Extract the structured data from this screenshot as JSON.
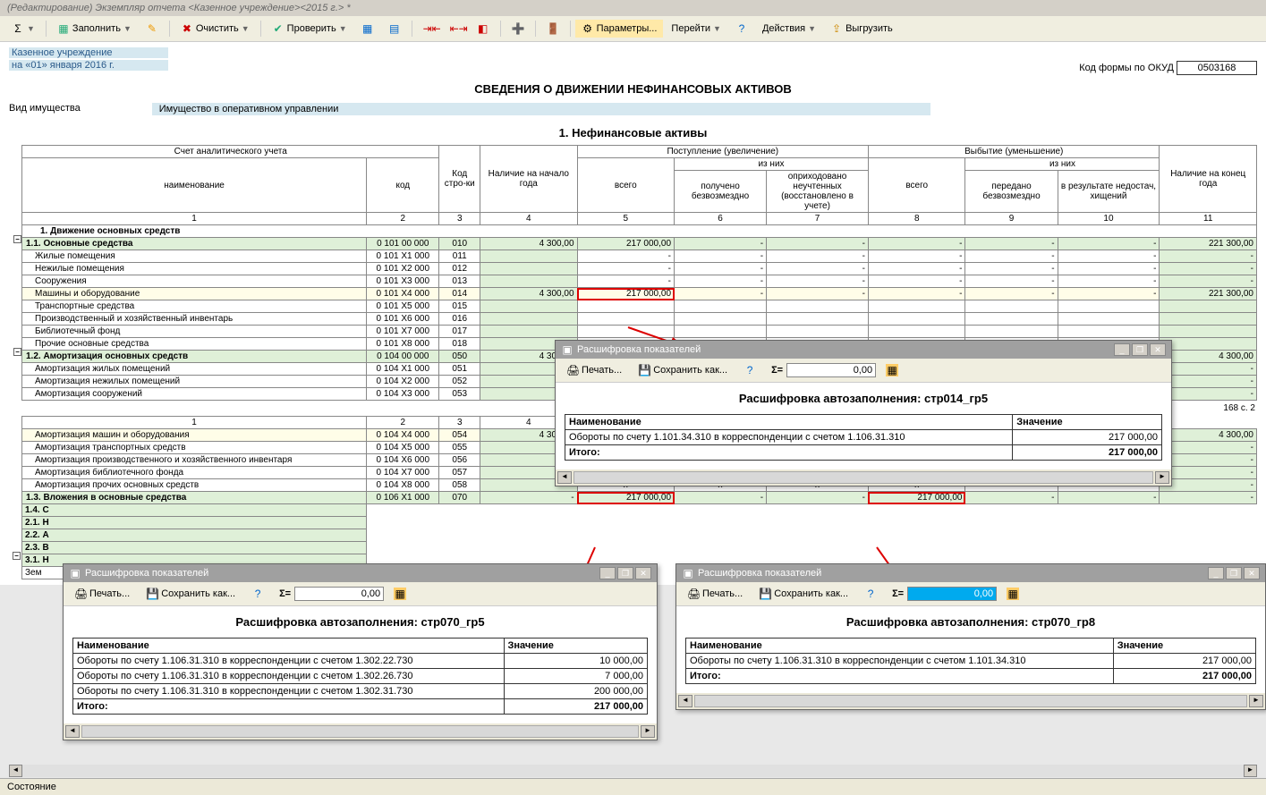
{
  "window_title": "(Редактирование) Экземпляр отчета <Казенное учреждение><2015 г.> *",
  "toolbar": {
    "fill": "Заполнить",
    "clear": "Очистить",
    "check": "Проверить",
    "params": "Параметры...",
    "goto": "Перейти",
    "actions": "Действия",
    "export": "Выгрузить"
  },
  "header": {
    "org": "Казенное учреждение",
    "date": "на «01» января 2016 г.",
    "okud_label": "Код формы по ОКУД",
    "okud_value": "0503168",
    "main_title": "СВЕДЕНИЯ О ДВИЖЕНИИ НЕФИНАНСОВЫХ АКТИВОВ",
    "prop_type_label": "Вид имущества",
    "prop_type_value": "Имущество в оперативном управлении",
    "section_title": "1. Нефинансовые активы"
  },
  "columns": {
    "acc_group": "Счет аналитического учета",
    "name": "наименование",
    "code": "код",
    "line_code": "Код стро-ки",
    "begin": "Наличие на начало года",
    "inc_group": "Поступление (увеличение)",
    "inc_total": "всего",
    "inc_sub": "из них",
    "inc_free": "получено безвозмездно",
    "inc_rest": "оприходовано неучтенных (восстановлено в учете)",
    "dec_group": "Выбытие (уменьшение)",
    "dec_total": "всего",
    "dec_sub": "из них",
    "dec_free": "передано безвозмездно",
    "dec_loss": "в результате недостач, хищений",
    "end": "Наличие на конец года"
  },
  "rows": [
    {
      "t": "cat",
      "name": "1. Движение основных средств"
    },
    {
      "t": "sum",
      "name": "1.1. Основные средства",
      "code": "0 101 00 000",
      "line": "010",
      "begin": "4 300,00",
      "inc_t": "217 000,00",
      "inc_f": "-",
      "inc_r": "-",
      "dec_t": "-",
      "dec_f": "-",
      "dec_l": "-",
      "end": "221 300,00",
      "tree": true
    },
    {
      "t": "data",
      "name": "Жилые помещения",
      "code": "0 101 X1 000",
      "line": "011",
      "begin": "",
      "inc_t": "-",
      "inc_f": "-",
      "inc_r": "-",
      "dec_t": "-",
      "dec_f": "-",
      "dec_l": "-",
      "end": "-"
    },
    {
      "t": "data",
      "name": "Нежилые помещения",
      "code": "0 101 X2 000",
      "line": "012",
      "begin": "",
      "inc_t": "-",
      "inc_f": "-",
      "inc_r": "-",
      "dec_t": "-",
      "dec_f": "-",
      "dec_l": "-",
      "end": "-"
    },
    {
      "t": "data",
      "name": "Сооружения",
      "code": "0 101 X3 000",
      "line": "013",
      "begin": "",
      "inc_t": "-",
      "inc_f": "-",
      "inc_r": "-",
      "dec_t": "-",
      "dec_f": "-",
      "dec_l": "-",
      "end": "-"
    },
    {
      "t": "ed",
      "name": "Машины и оборудование",
      "code": "0 101 X4 000",
      "line": "014",
      "begin": "4 300,00",
      "inc_t": "217 000,00",
      "inc_f": "-",
      "inc_r": "-",
      "dec_t": "-",
      "dec_f": "-",
      "dec_l": "-",
      "end": "221 300,00",
      "red5": true
    },
    {
      "t": "data",
      "name": "Транспортные средства",
      "code": "0 101 X5 000",
      "line": "015",
      "begin": ""
    },
    {
      "t": "data",
      "name": "Производственный и хозяйственный инвентарь",
      "code": "0 101 X6 000",
      "line": "016",
      "begin": ""
    },
    {
      "t": "data",
      "name": "Библиотечный фонд",
      "code": "0 101 X7 000",
      "line": "017",
      "begin": ""
    },
    {
      "t": "data",
      "name": "Прочие основные средства",
      "code": "0 101 X8 000",
      "line": "018",
      "begin": ""
    },
    {
      "t": "sum",
      "name": "1.2. Амортизация основных средств",
      "code": "0 104 00 000",
      "line": "050",
      "begin": "4 300,00",
      "end": "4 300,00",
      "tree": true
    },
    {
      "t": "data",
      "name": "Амортизация жилых помещений",
      "code": "0 104 X1 000",
      "line": "051",
      "begin": "-",
      "end": "-"
    },
    {
      "t": "data",
      "name": "Амортизация нежилых помещений",
      "code": "0 104 X2 000",
      "line": "052",
      "begin": "-",
      "end": "-"
    },
    {
      "t": "data",
      "name": "Амортизация сооружений",
      "code": "0 104 X3 000",
      "line": "053",
      "begin": "-",
      "end": "-"
    }
  ],
  "page_footer": "168 с. 2",
  "num_header": {
    "c1": "1",
    "c2": "2",
    "c3": "3",
    "c4": "4"
  },
  "rows2": [
    {
      "t": "ed",
      "name": "Амортизация машин и оборудования",
      "code": "0 104 X4 000",
      "line": "054",
      "begin": "4 300,00",
      "end": "4 300,00"
    },
    {
      "t": "data",
      "name": "Амортизация транспортных средств",
      "code": "0 104 X5 000",
      "line": "055",
      "begin": "-",
      "end": "-"
    },
    {
      "t": "data",
      "name": "Амортизация производственного и хозяйственного инвентаря",
      "code": "0 104 X6 000",
      "line": "056",
      "begin": "-",
      "end": "-"
    },
    {
      "t": "data",
      "name": "Амортизация библиотечного фонда",
      "code": "0 104 X7 000",
      "line": "057",
      "begin": "-",
      "end": "-"
    },
    {
      "t": "data",
      "name": "Амортизация прочих основных средств",
      "code": "0 104 X8 000",
      "line": "058",
      "begin": "-",
      "inc_t": "x",
      "inc_f": "x",
      "inc_r": "x",
      "dec_t": "x",
      "dec_f": "",
      "dec_l": "",
      "end": "-"
    },
    {
      "t": "sum",
      "name": "1.3. Вложения в основные средства",
      "code": "0 106 X1 000",
      "line": "070",
      "begin": "-",
      "inc_t": "217 000,00",
      "inc_f": "-",
      "inc_r": "-",
      "dec_t": "217 000,00",
      "dec_f": "-",
      "dec_l": "-",
      "end": "-",
      "red5": true,
      "red8": true
    },
    {
      "t": "sum",
      "name": "1.4. С",
      "short": true
    },
    {
      "t": "sum",
      "name": "2.1. Н",
      "short": true
    },
    {
      "t": "sum",
      "name": "2.2. А",
      "short": true
    },
    {
      "t": "sum",
      "name": "2.3. В",
      "short": true
    },
    {
      "t": "sum",
      "name": "3.1. Н",
      "short": true,
      "tree": true
    },
    {
      "t": "data",
      "name": "Зем",
      "short": true
    }
  ],
  "popup_shared": {
    "title": "Расшифровка показателей",
    "print": "Печать...",
    "save": "Сохранить как...",
    "name_col": "Наименование",
    "val_col": "Значение",
    "total": "Итого:",
    "sigma_val": "0,00"
  },
  "popup1": {
    "heading": "Расшифровка автозаполнения: стр014_гр5",
    "rows": [
      {
        "n": "Обороты по счету 1.101.34.310 в корреспонденции с счетом 1.106.31.310",
        "v": "217 000,00"
      }
    ],
    "total_val": "217 000,00"
  },
  "popup2": {
    "heading": "Расшифровка автозаполнения: стр070_гр5",
    "rows": [
      {
        "n": "Обороты по счету 1.106.31.310 в корреспонденции с счетом 1.302.22.730",
        "v": "10 000,00"
      },
      {
        "n": "Обороты по счету 1.106.31.310 в корреспонденции с счетом 1.302.26.730",
        "v": "7 000,00"
      },
      {
        "n": "Обороты по счету 1.106.31.310 в корреспонденции с счетом 1.302.31.730",
        "v": "200 000,00"
      }
    ],
    "total_val": "217 000,00"
  },
  "popup3": {
    "heading": "Расшифровка автозаполнения: стр070_гр8",
    "sigma_val": "0,00",
    "rows": [
      {
        "n": "Обороты по счету 1.106.31.310 в корреспонденции с счетом 1.101.34.310",
        "v": "217 000,00"
      }
    ],
    "total_val": "217 000,00"
  },
  "status": "Состояние"
}
